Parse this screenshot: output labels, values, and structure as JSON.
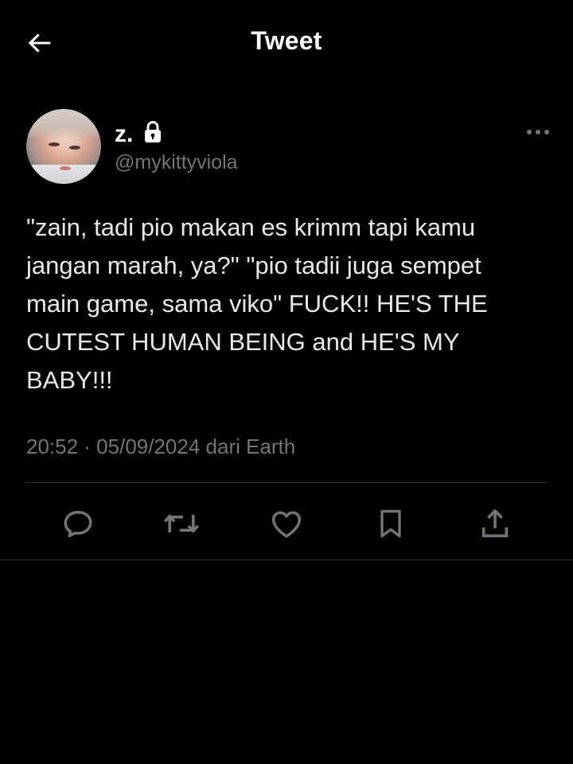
{
  "header": {
    "title": "Tweet",
    "back_icon": "arrow-left-icon"
  },
  "author": {
    "display_name": "z.",
    "handle": "@mykittyviola",
    "protected_icon": "lock-icon",
    "more_icon": "more-horizontal-icon"
  },
  "tweet": {
    "text": "\"zain, tadi pio makan es krimm tapi kamu jangan marah, ya?\" \"pio tadii juga sempet main game, sama viko\" FUCK!! HE'S THE CUTEST HUMAN BEING and HE'S MY BABY!!!",
    "timestamp": "20:52 · 05/09/2024 dari Earth"
  },
  "actions": [
    {
      "name": "reply",
      "icon": "reply-icon"
    },
    {
      "name": "retweet",
      "icon": "retweet-icon"
    },
    {
      "name": "like",
      "icon": "heart-icon"
    },
    {
      "name": "bookmark",
      "icon": "bookmark-icon"
    },
    {
      "name": "share",
      "icon": "share-icon"
    }
  ],
  "colors": {
    "background": "#000000",
    "primary_text": "#e7e9ea",
    "secondary_text": "#71767b",
    "divider": "#2f3336",
    "icon": "#71767b"
  }
}
